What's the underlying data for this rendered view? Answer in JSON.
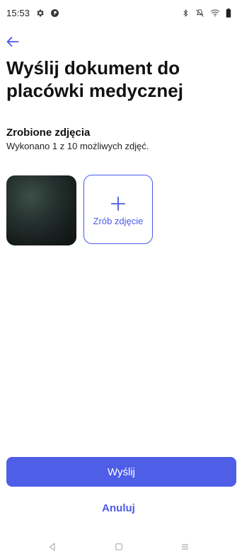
{
  "status_bar": {
    "time": "15:53",
    "icons": [
      "settings-icon",
      "vpn-icon",
      "bluetooth-icon",
      "mute-icon",
      "wifi-icon",
      "battery-icon"
    ]
  },
  "header": {
    "back_icon": "arrow-left-icon",
    "title": "Wyślij dokument do placówki medycznej"
  },
  "photos": {
    "section_title": "Zrobione zdjęcia",
    "summary": "Wykonano 1 z 10 możliwych zdjęć.",
    "add_photo_label": "Zrób zdjęcie"
  },
  "actions": {
    "send_label": "Wyślij",
    "cancel_label": "Anuluj"
  },
  "nav_bar": {
    "icons": [
      "back-nav-icon",
      "home-nav-icon",
      "recents-nav-icon"
    ]
  },
  "colors": {
    "accent": "#4e5ee6",
    "text_primary": "#111111",
    "background": "#ffffff"
  }
}
